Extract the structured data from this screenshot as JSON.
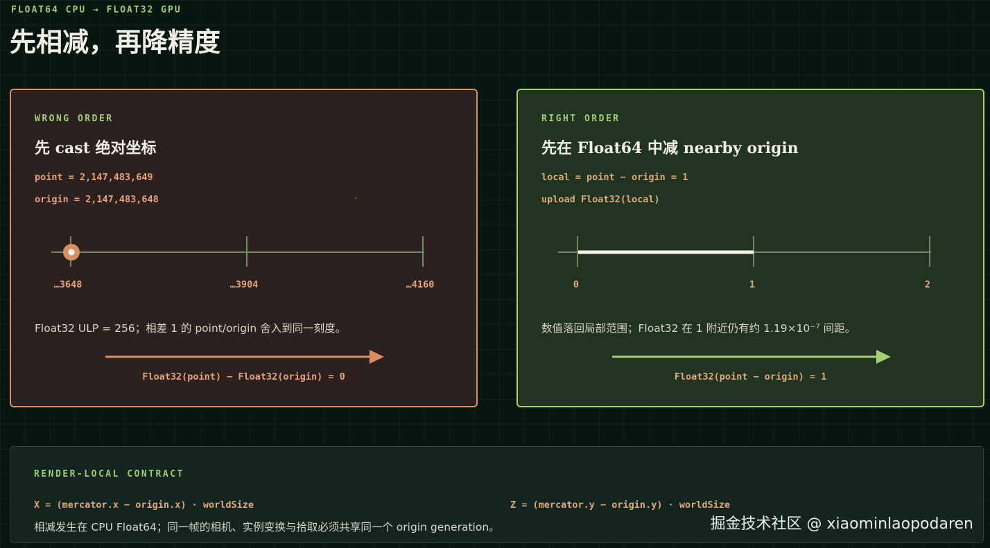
{
  "header": {
    "eyebrow": "FLOAT64 CPU → FLOAT32 GPU",
    "title": "先相减，再降精度"
  },
  "panels": {
    "wrong": {
      "label": "WRONG ORDER",
      "heading": "先 cast 绝对坐标",
      "code": [
        "point = 2,147,483,649",
        "origin = 2,147,483,648"
      ],
      "ticks": [
        "…3648",
        "…3904",
        "…4160"
      ],
      "note": "Float32 ULP = 256；相差 1 的 point/origin 舍入到同一刻度。",
      "result": "Float32(point) − Float32(origin) = 0",
      "accent": "#d98e63"
    },
    "right": {
      "label": "RIGHT ORDER",
      "heading": "先在 Float64 中减 nearby origin",
      "code": [
        "local = point − origin = 1",
        "upload Float32(local)"
      ],
      "ticks": [
        "0",
        "1",
        "2"
      ],
      "note": "数值落回局部范围；Float32 在 1 附近仍有约 1.19×10⁻⁷ 间距。",
      "result": "Float32(point − origin) = 1",
      "accent": "#a3d070"
    }
  },
  "contract": {
    "label": "RENDER-LOCAL CONTRACT",
    "formula_x": "X = (mercator.x − origin.x) · worldSize",
    "formula_z": "Z = (mercator.y − origin.y) · worldSize",
    "note": "相减发生在 CPU Float64；同一帧的相机、实例变换与拾取必须共享同一个 origin generation。"
  },
  "watermark": "掘金技术社区 @ xiaominlaopodaren"
}
